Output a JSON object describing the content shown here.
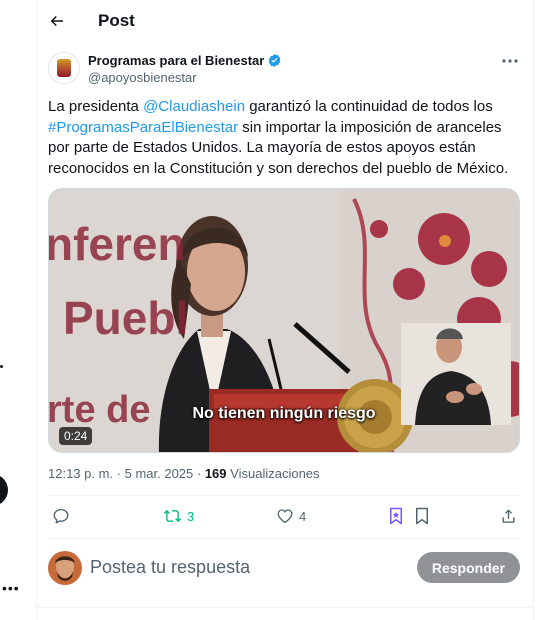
{
  "header": {
    "title": "Post"
  },
  "author": {
    "name": "Programas para el Bienestar",
    "handle": "@apoyosbienestar"
  },
  "tweet": {
    "t1": "La presidenta ",
    "mention": "@Claudiashein",
    "t2": " garantizó la continuidad de todos los ",
    "hashtag": "#ProgramasParaElBienestar",
    "t3": " sin importar la imposición de aranceles por parte de Estados Unidos. La mayoría de estos apoyos están reconocidos en la Constitución y son derechos del pueblo de México."
  },
  "media": {
    "subtitle": "No tienen ningún riesgo",
    "time": "0:24",
    "bg_line1": "nferen",
    "bg_line2": "Puebl",
    "bg_line3": "rte de"
  },
  "meta": {
    "time": "12:13 p. m.",
    "sep": " · ",
    "date": "5 mar. 2025",
    "views_count": "169",
    "views_label": "Visualizaciones"
  },
  "actions": {
    "retweets": "3",
    "likes": "4"
  },
  "reply": {
    "placeholder": "Postea tu respuesta",
    "button": "Responder"
  },
  "colors": {
    "link": "#1d9bf0",
    "retweet": "#00ba7c",
    "bookmark_accent": "#7856ff"
  }
}
